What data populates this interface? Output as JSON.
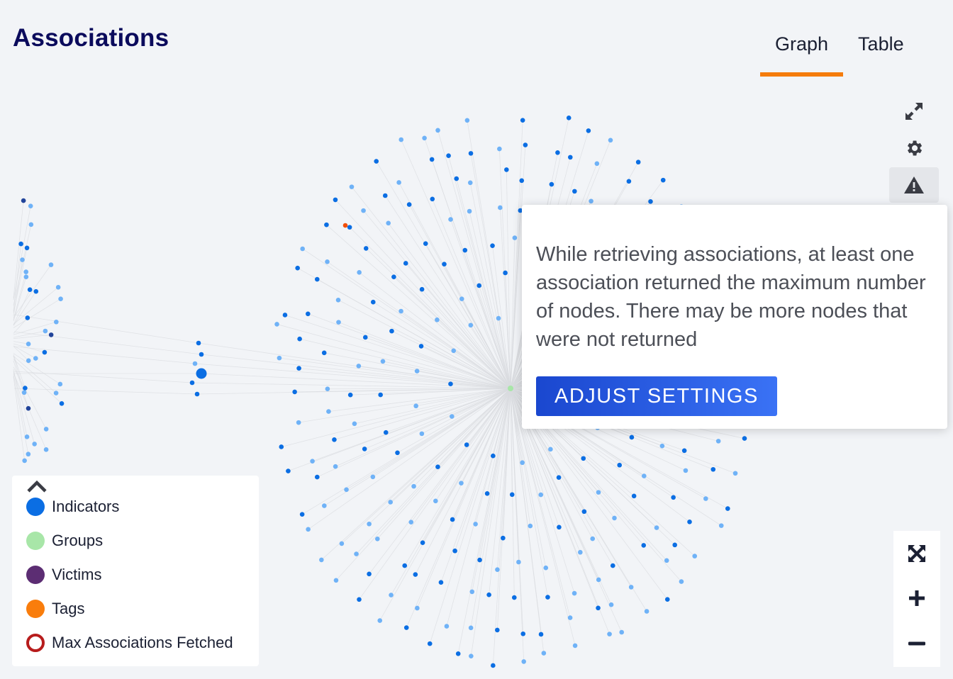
{
  "header": {
    "title": "Associations"
  },
  "tabs": [
    {
      "label": "Graph",
      "active": true
    },
    {
      "label": "Table",
      "active": false
    }
  ],
  "toolbar": {
    "expand_icon": "expand-arrows-icon",
    "settings_icon": "gear-icon",
    "warning_icon": "warning-triangle-icon"
  },
  "popover": {
    "message": "While retrieving associations, at least one association returned the maximum number of nodes. There may be more nodes that were not returned",
    "button_label": "ADJUST SETTINGS"
  },
  "legend": {
    "collapse_icon": "chevron-up-icon",
    "items": [
      {
        "label": "Indicators",
        "color": "#0b6ee3",
        "style": "filled"
      },
      {
        "label": "Groups",
        "color": "#a8e6a8",
        "style": "filled"
      },
      {
        "label": "Victims",
        "color": "#5c2d73",
        "style": "filled"
      },
      {
        "label": "Tags",
        "color": "#f97d0c",
        "style": "filled"
      },
      {
        "label": "Max Associations Fetched",
        "color": "#b71c1c",
        "style": "ring"
      }
    ]
  },
  "zoom_controls": {
    "fit_icon": "fit-to-screen-icon",
    "zoom_in_icon": "plus-icon",
    "zoom_out_icon": "minus-icon"
  },
  "graph_colors": {
    "indicator_dark": "#0b6ee3",
    "indicator_light": "#6fb2f7",
    "group": "#a8e6a8",
    "victim": "#22449a",
    "tag": "#f24f0a",
    "edge": "#d9dbdf"
  }
}
